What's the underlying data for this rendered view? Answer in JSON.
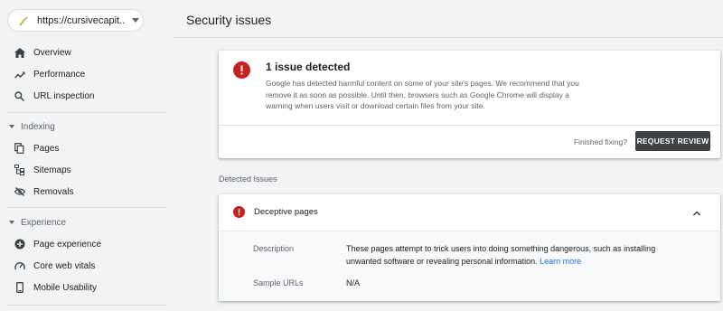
{
  "property": {
    "url": "https://cursivecapit..."
  },
  "sidebar": {
    "items": [
      {
        "label": "Overview",
        "icon": "home-icon"
      },
      {
        "label": "Performance",
        "icon": "trending-up-icon"
      },
      {
        "label": "URL inspection",
        "icon": "search-icon"
      }
    ],
    "sections": [
      {
        "title": "Indexing",
        "items": [
          {
            "label": "Pages",
            "icon": "pages-icon"
          },
          {
            "label": "Sitemaps",
            "icon": "sitemap-icon"
          },
          {
            "label": "Removals",
            "icon": "eye-off-icon"
          }
        ]
      },
      {
        "title": "Experience",
        "items": [
          {
            "label": "Page experience",
            "icon": "add-circle-icon"
          },
          {
            "label": "Core web vitals",
            "icon": "speed-icon"
          },
          {
            "label": "Mobile Usability",
            "icon": "smartphone-icon"
          }
        ]
      }
    ]
  },
  "main": {
    "title": "Security issues",
    "issue_card": {
      "title": "1 issue detected",
      "description": "Google has detected harmful content on some of your site's pages. We recommend that you remove it as soon as possible. Until then, browsers such as Google Chrome will display a warning when users visit or download certain files from your site.",
      "finished_text": "Finished fixing?",
      "review_button": "REQUEST REVIEW"
    },
    "detected_label": "Detected Issues",
    "detail": {
      "title": "Deceptive pages",
      "description_label": "Description",
      "description_text": "These pages attempt to trick users into doing something dangerous, such as installing unwanted software or revealing personal information.",
      "learn_more": "Learn more",
      "sample_label": "Sample URLs",
      "sample_value": "N/A"
    }
  },
  "colors": {
    "error": "#c5221f",
    "link": "#1a73e8",
    "button": "#3c4043"
  }
}
